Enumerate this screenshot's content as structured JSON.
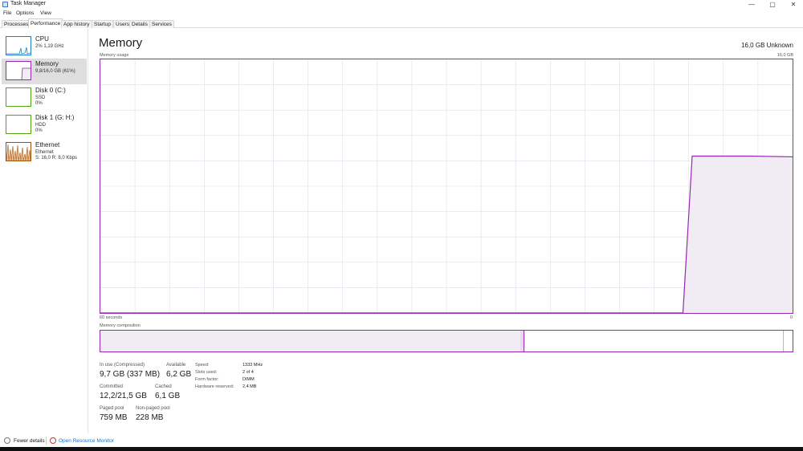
{
  "window": {
    "title": "Task Manager",
    "min": "—",
    "max": "▢",
    "close": "✕"
  },
  "menu": [
    "File",
    "Options",
    "View"
  ],
  "tabs": [
    "Processes",
    "Performance",
    "App history",
    "Startup",
    "Users",
    "Details",
    "Services"
  ],
  "active_tab": "Performance",
  "sidebar": {
    "items": [
      {
        "name": "CPU",
        "sub1": "2% 1,19 GHz",
        "color": "#1d7dbf"
      },
      {
        "name": "Memory",
        "sub1": "9,8/16,0 GB (61%)",
        "color": "#9528b4"
      },
      {
        "name": "Disk 0 (C:)",
        "sub1": "SSD",
        "sub2": "0%",
        "color": "#4da60c"
      },
      {
        "name": "Disk 1 (G: H:)",
        "sub1": "HDD",
        "sub2": "0%",
        "color": "#4da60c"
      },
      {
        "name": "Ethernet",
        "sub1": "Ethernet",
        "sub2": "S: 16,0  R: 8,0 Kbps",
        "color": "#a74f01"
      }
    ]
  },
  "main": {
    "title": "Memory",
    "capacity": "16,0 GB Unknown",
    "usage_label": "Memory usage",
    "usage_max": "16,0 GB",
    "time_left": "60 seconds",
    "time_right": "0",
    "composition_label": "Memory composition",
    "stats": {
      "in_use_label": "In use (Compressed)",
      "in_use": "9,7 GB (337 MB)",
      "available_label": "Available",
      "available": "6,2 GB",
      "committed_label": "Committed",
      "committed": "12,2/21,5 GB",
      "cached_label": "Cached",
      "cached": "6,1 GB",
      "paged_label": "Paged pool",
      "paged": "759 MB",
      "nonpaged_label": "Non-paged pool",
      "nonpaged": "228 MB"
    },
    "specs": {
      "speed_label": "Speed:",
      "speed": "1333 MHz",
      "slots_label": "Slots used:",
      "slots": "2 of 4",
      "form_label": "Form factor:",
      "form": "DIMM",
      "hw_label": "Hardware reserved:",
      "hw": "2,4 MB"
    }
  },
  "usage_series": {
    "x_seconds_ago": [
      60,
      9.5,
      8.7,
      6,
      3.7,
      0
    ],
    "gb": [
      0,
      0,
      9.9,
      9.9,
      9.9,
      9.85
    ]
  },
  "composition": {
    "in_use_gb": 9.7,
    "modified_gb": 0.1,
    "standby_gb": 6.0,
    "free_gb": 0.2,
    "total_gb": 16.0
  },
  "footer": {
    "fewer": "Fewer details",
    "resmon": "Open Resource Monitor"
  },
  "colors": {
    "memory": "#9528b4",
    "memory_fill": "#f1ebf3",
    "grid": "#e6dbea",
    "link": "#1a6fc9"
  }
}
